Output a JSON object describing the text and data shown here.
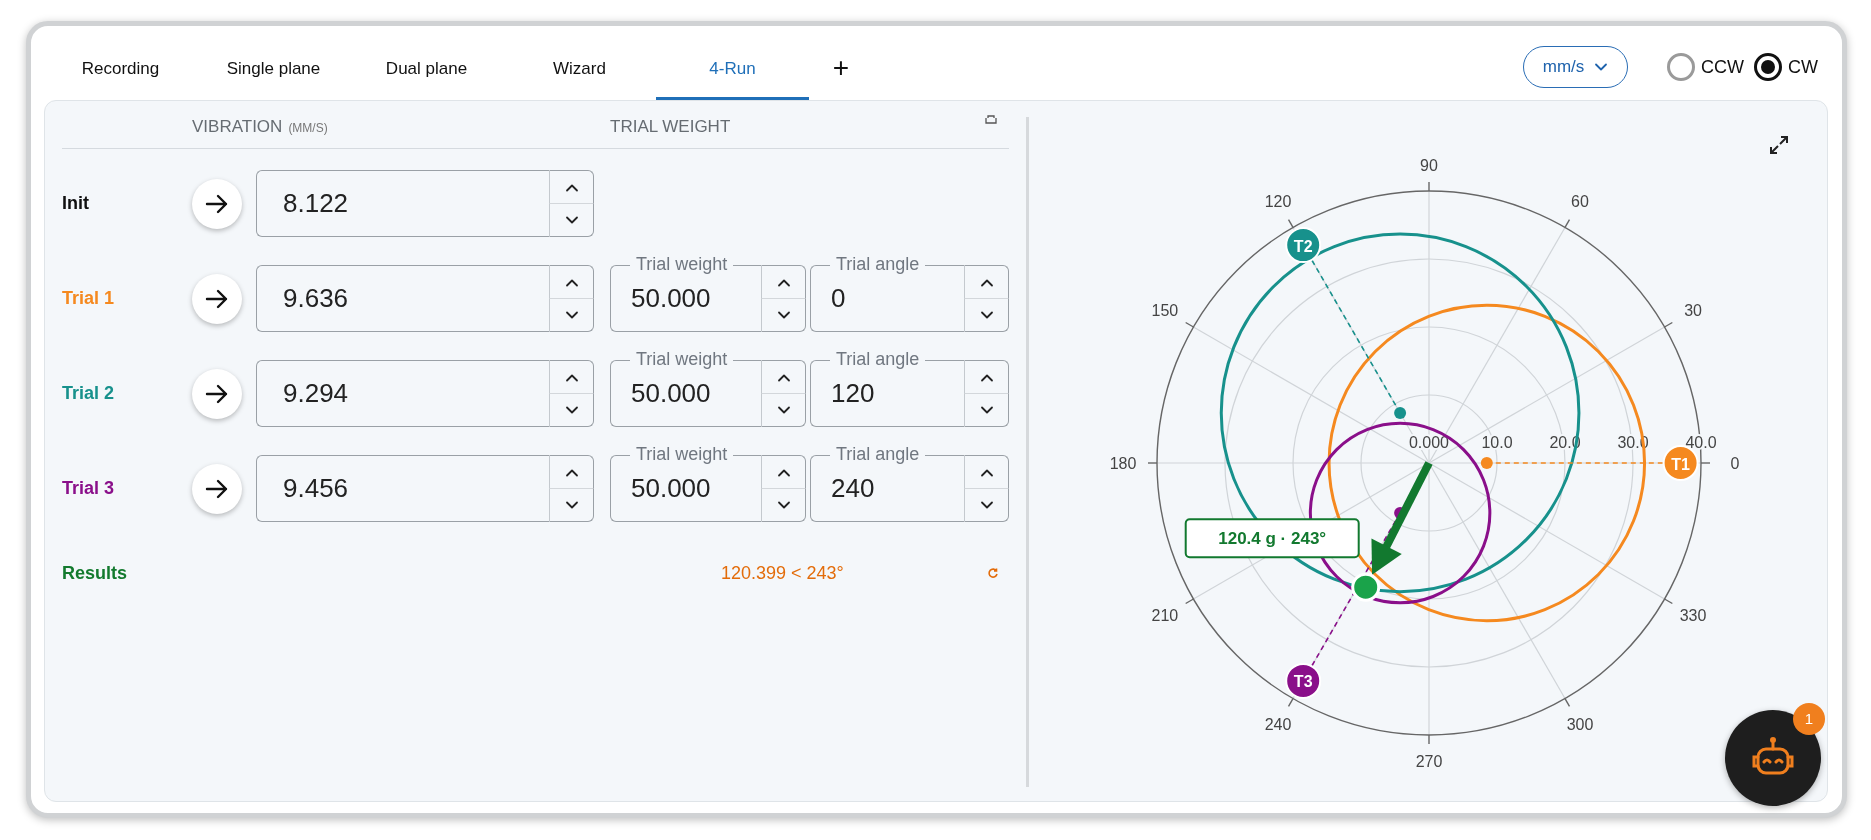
{
  "tabs": [
    {
      "label": "Recording",
      "selected": false
    },
    {
      "label": "Single plane",
      "selected": false
    },
    {
      "label": "Dual plane",
      "selected": false
    },
    {
      "label": "Wizard",
      "selected": false
    },
    {
      "label": "4-Run",
      "selected": true
    }
  ],
  "add_tab": "+",
  "unit_select": {
    "value": "mm/s"
  },
  "direction": [
    {
      "label": "CCW",
      "selected": false
    },
    {
      "label": "CW",
      "selected": true
    }
  ],
  "table": {
    "columns": [
      {
        "label": "VIBRATION",
        "unit": "(MM/S)"
      },
      {
        "label": "TRIAL WEIGHT"
      }
    ],
    "rows": [
      {
        "label": "Init",
        "color": "#111111",
        "vibration": "8.122"
      },
      {
        "label": "Trial 1",
        "color": "#f5891f",
        "vibration": "9.636",
        "trial_weight": {
          "label": "Trial weight",
          "value": "50.000"
        },
        "trial_angle": {
          "label": "Trial angle",
          "value": "0"
        }
      },
      {
        "label": "Trial 2",
        "color": "#17918c",
        "vibration": "9.294",
        "trial_weight": {
          "label": "Trial weight",
          "value": "50.000"
        },
        "trial_angle": {
          "label": "Trial angle",
          "value": "120"
        }
      },
      {
        "label": "Trial 3",
        "color": "#8a0f8a",
        "vibration": "9.456",
        "trial_weight": {
          "label": "Trial weight",
          "value": "50.000"
        },
        "trial_angle": {
          "label": "Trial angle",
          "value": "240"
        }
      }
    ]
  },
  "results": {
    "label": "Results",
    "value": "120.399 < 243°"
  },
  "polar_plot": {
    "angle_labels": [
      "0",
      "30",
      "60",
      "90",
      "120",
      "150",
      "180",
      "210",
      "240",
      "270",
      "300",
      "330"
    ],
    "radius_labels": [
      "0.000",
      "10.0",
      "20.0",
      "30.0",
      "40.0"
    ],
    "markers": [
      {
        "label": "T1",
        "color": "#f5891f"
      },
      {
        "label": "T2",
        "color": "#17918c"
      },
      {
        "label": "T3",
        "color": "#8a0f8a"
      }
    ],
    "result": {
      "label": "120.4 g · 243°"
    }
  },
  "assistant": {
    "badge": "1"
  }
}
